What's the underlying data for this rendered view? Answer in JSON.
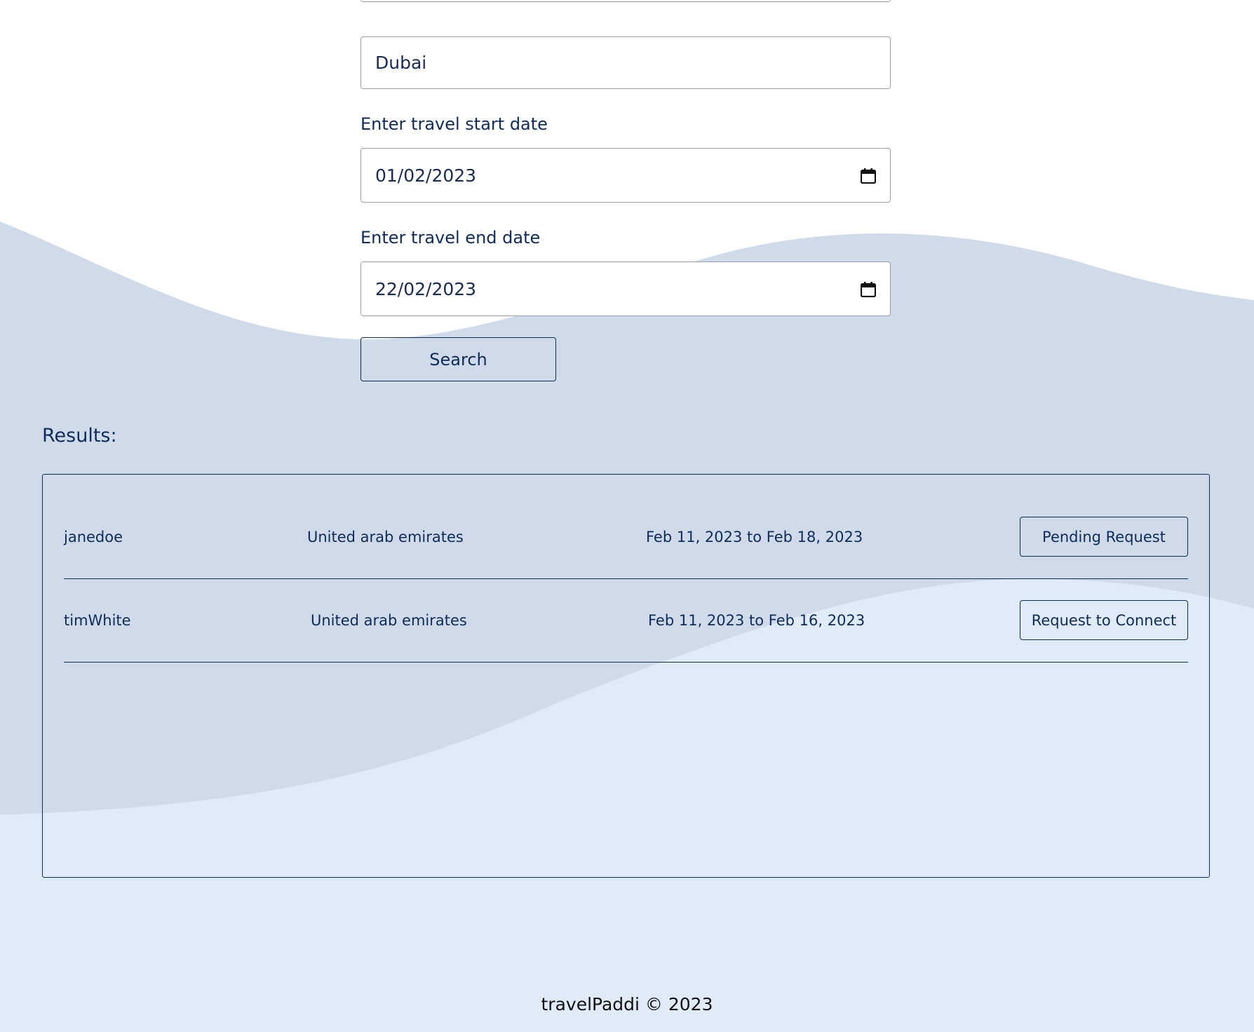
{
  "form": {
    "destination_value": "Dubai",
    "start_date_label": "Enter travel start date",
    "start_date_value": "01/02/2023",
    "end_date_label": "Enter travel end date",
    "end_date_value": "22/02/2023",
    "search_label": "Search"
  },
  "results": {
    "title": "Results:",
    "rows": [
      {
        "username": "janedoe",
        "country": "United arab emirates",
        "dates": "Feb 11, 2023 to Feb 18, 2023",
        "action": "Pending Request"
      },
      {
        "username": "timWhite",
        "country": "United arab emirates",
        "dates": "Feb 11, 2023 to Feb 16, 2023",
        "action": "Request to Connect"
      }
    ]
  },
  "footer": {
    "text": "travelPaddi © 2023"
  },
  "icons": {
    "date_picker": "calendar-icon"
  },
  "colors": {
    "primary": "#0f2a5c",
    "wave_dark": "#cfdbe9",
    "wave_light": "#e0ebf9"
  }
}
